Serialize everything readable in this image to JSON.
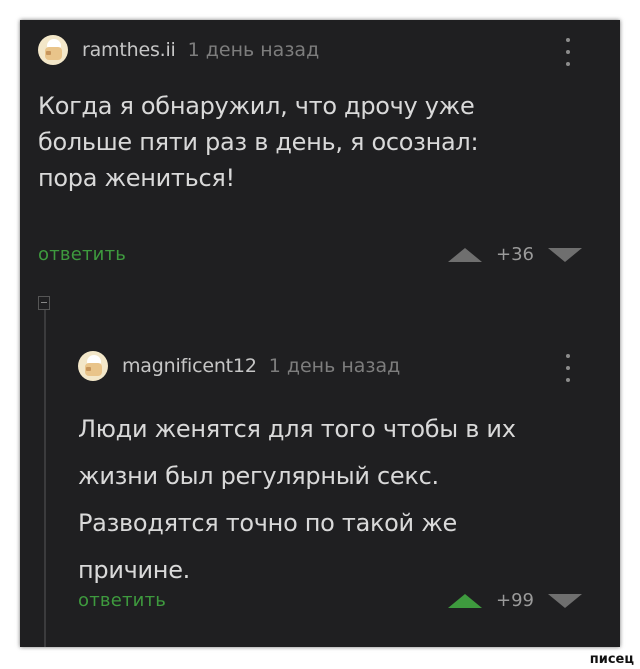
{
  "comments": [
    {
      "username": "ramthes.ii",
      "time": "1 день назад",
      "text": "Когда я обнаружил, что дрочу уже\nбольше пяти раз в день, я осознал:\nпора жениться!",
      "reply_label": "ответить",
      "rating": "+36"
    },
    {
      "username": "magnificent12",
      "time": "1 день назад",
      "text": "Люди женятся для того чтобы в их\nжизни был регулярный секс.\nРазводятся точно по такой же\nпричине.",
      "reply_label": "ответить",
      "rating": "+99"
    }
  ],
  "watermark": "писец",
  "colors": {
    "background": "#1f1f21",
    "accent": "#3e9a3e",
    "text": "#d9d9d9"
  }
}
